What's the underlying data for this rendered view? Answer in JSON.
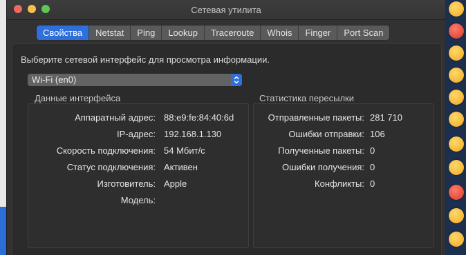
{
  "window": {
    "title": "Сетевая утилита"
  },
  "tabs": [
    {
      "label": "Свойства",
      "active": true
    },
    {
      "label": "Netstat",
      "active": false
    },
    {
      "label": "Ping",
      "active": false
    },
    {
      "label": "Lookup",
      "active": false
    },
    {
      "label": "Traceroute",
      "active": false
    },
    {
      "label": "Whois",
      "active": false
    },
    {
      "label": "Finger",
      "active": false
    },
    {
      "label": "Port Scan",
      "active": false
    }
  ],
  "info": {
    "instruction": "Выберите сетевой интерфейс для просмотра информации.",
    "interface_selected": "Wi-Fi (en0)",
    "interface_group": {
      "title": "Данные интерфейса",
      "rows": [
        {
          "label": "Аппаратный адрес:",
          "value": "88:e9:fe:84:40:6d"
        },
        {
          "label": "IP-адрес:",
          "value": "192.168.1.130"
        },
        {
          "label": "Скорость подключения:",
          "value": "54 Мбит/с"
        },
        {
          "label": "Статус подключения:",
          "value": "Активен"
        },
        {
          "label": "Изготовитель:",
          "value": "Apple"
        },
        {
          "label": "Модель:",
          "value": ""
        }
      ]
    },
    "stats_group": {
      "title": "Статистика пересылки",
      "rows": [
        {
          "label": "Отправленные пакеты:",
          "value": "281 710"
        },
        {
          "label": "Ошибки отправки:",
          "value": "106"
        },
        {
          "label": "Полученные пакеты:",
          "value": "0"
        },
        {
          "label": "Ошибки получения:",
          "value": "0"
        },
        {
          "label": "Конфликты:",
          "value": "0"
        }
      ]
    }
  },
  "colors": {
    "accent": "#2f6fdb",
    "window_bg": "#323232",
    "close": "#ed6a5e",
    "minimize": "#f5bf4f",
    "zoom": "#61c554"
  },
  "icons": {
    "select_arrows": "chevron-up-down-icon"
  }
}
